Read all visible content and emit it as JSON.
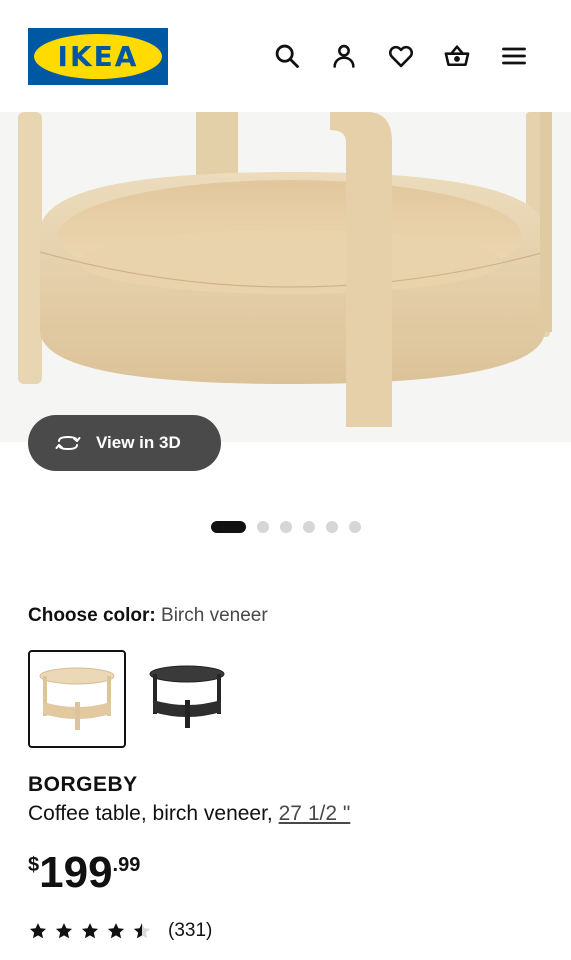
{
  "header": {
    "logo_text": "IKEA",
    "icons": [
      "search-icon",
      "account-icon",
      "heart-icon",
      "basket-icon",
      "menu-icon"
    ]
  },
  "gallery": {
    "view_3d_label": "View in 3D",
    "image_count": 6,
    "active_index": 0
  },
  "color_chooser": {
    "label": "Choose color:",
    "selected_value": "Birch veneer",
    "options": [
      "Birch veneer",
      "Black"
    ]
  },
  "product": {
    "name": "BORGEBY",
    "description": "Coffee table, birch veneer,",
    "size_link": "27 1/2 \""
  },
  "price": {
    "currency": "$",
    "integer": "199",
    "decimal": ".99"
  },
  "rating": {
    "stars": 4.5,
    "count": "(331)"
  },
  "colors": {
    "ikea_blue": "#0058a3",
    "ikea_yellow": "#ffdb00",
    "birch": "#e7d2ae"
  }
}
